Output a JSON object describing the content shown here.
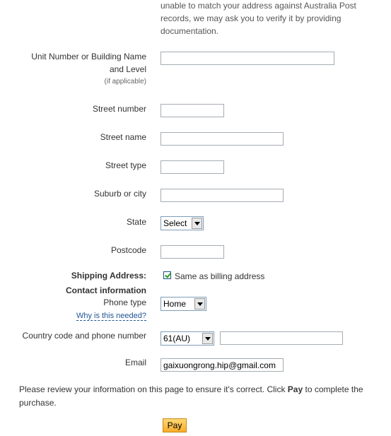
{
  "intro_text": "unable to match your address against Australia Post records, we may ask you to verify it by providing documentation.",
  "address": {
    "unit_label_line1": "Unit Number or Building Name",
    "unit_label_line2": "and Level",
    "unit_label_note": "(if applicable)",
    "unit_value": "",
    "street_number_label": "Street number",
    "street_number_value": "",
    "street_name_label": "Street name",
    "street_name_value": "",
    "street_type_label": "Street type",
    "street_type_value": "",
    "suburb_label": "Suburb or city",
    "suburb_value": "",
    "state_label": "State",
    "state_selected": "Select",
    "postcode_label": "Postcode",
    "postcode_value": ""
  },
  "shipping": {
    "label": "Shipping Address:",
    "same_as_billing_label": "Same as billing address",
    "same_as_billing_checked": true
  },
  "contact": {
    "heading": "Contact information",
    "phone_type_label": "Phone type",
    "phone_type_selected": "Home",
    "why_needed_link": "Why is this needed?",
    "country_code_label": "Country code and phone number",
    "country_code_selected": "61(AU)",
    "phone_value": "",
    "email_label": "Email",
    "email_value": "gaixuongrong.hip@gmail.com"
  },
  "review": {
    "text_before": "Please review your information on this page to ensure it's correct. Click ",
    "text_bold": "Pay",
    "text_after": " to complete the purchase."
  },
  "pay_button_label": "Pay",
  "colors": {
    "pay_button_top": "#fdd776",
    "pay_button_bottom": "#f7ac29",
    "link": "#1e5494",
    "input_border": "#a5acb2"
  }
}
